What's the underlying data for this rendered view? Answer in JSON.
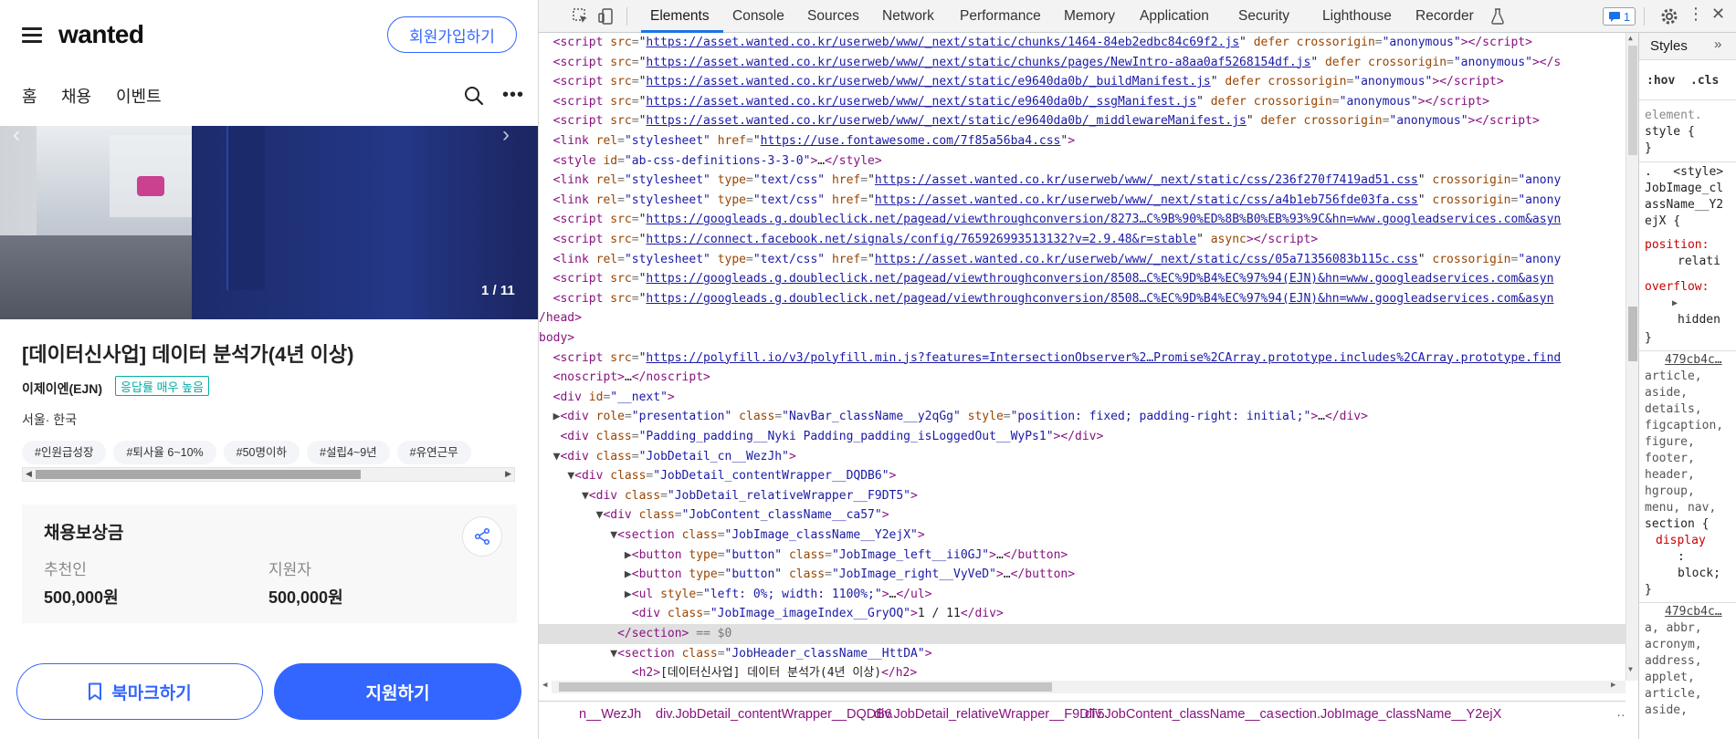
{
  "mobile": {
    "logo": "wanted",
    "signup_button": "회원가입하기",
    "nav": [
      "홈",
      "채용",
      "이벤트"
    ],
    "image_index": "1 / 11",
    "job_title": "[데이터신사업] 데이터 분석가(4년 이상)",
    "company": "이제이엔(EJN)",
    "response_badge": "응답률 매우 높음",
    "location": "서울· 한국",
    "tags": [
      "#인원급성장",
      "#퇴사율 6~10%",
      "#50명이하",
      "#설립4~9년",
      "#유연근무"
    ],
    "reward": {
      "title": "채용보상금",
      "recommender_label": "추천인",
      "recommender_value": "500,000원",
      "applicant_label": "지원자",
      "applicant_value": "500,000원"
    },
    "bookmark_button": "북마크하기",
    "apply_button": "지원하기",
    "brand_color": "#3366ff"
  },
  "devtools": {
    "tabs": [
      "Elements",
      "Console",
      "Sources",
      "Network",
      "Performance",
      "Memory",
      "Application",
      "Security",
      "Lighthouse",
      "Recorder"
    ],
    "active_tab": "Elements",
    "issues_count": "1",
    "styles_tab": "Styles",
    "hov": ":hov",
    "cls": ".cls",
    "breadcrumbs": [
      "n__WezJh",
      "div.JobDetail_contentWrapper__DQDB6",
      "div.JobDetail_relativeWrapper__F9DT5",
      "div.JobContent_className__ca57",
      "section.JobImage_className__Y2ejX"
    ],
    "styles": {
      "rule1": [
        "element.",
        "style {",
        "}"
      ],
      "rule2_source": ".   <style>",
      "rule2_selector": [
        "JobImage_cl",
        "assName__Y2",
        "ejX {"
      ],
      "rule2_props": [
        "position:",
        "relati",
        "overflow:",
        "hidden",
        "}"
      ],
      "rule3_source": "479cb4c…",
      "rule3_selectors": [
        "article,",
        "aside,",
        "details,",
        "figcaption,",
        "figure,",
        "footer,",
        "header,",
        "hgroup,",
        "menu, nav,",
        "section {"
      ],
      "rule3_props": [
        "display",
        ":",
        "block;",
        "}"
      ],
      "rule4_source": "479cb4c…",
      "rule4_selectors": [
        "a, abbr,",
        "acronym,",
        "address,",
        "applet,",
        "article,",
        "aside,"
      ]
    }
  }
}
